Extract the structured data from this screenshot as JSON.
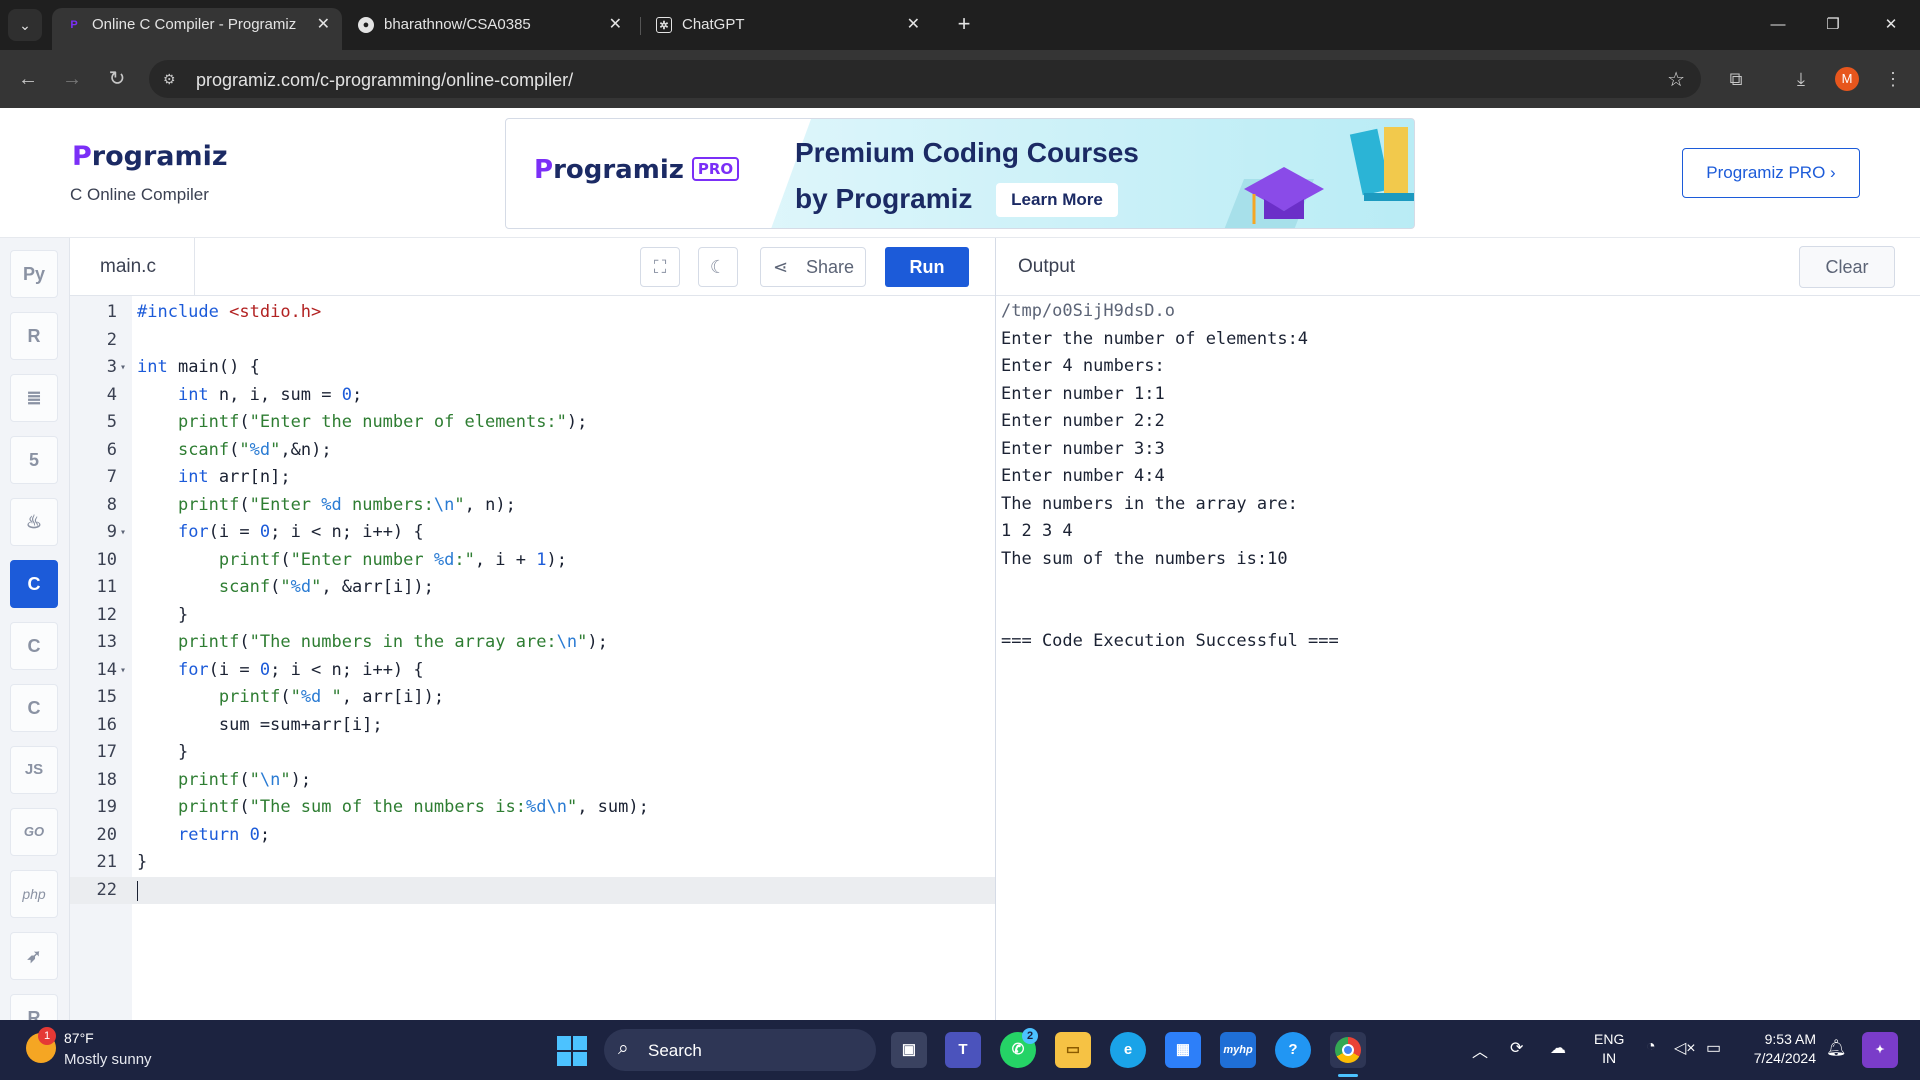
{
  "browser": {
    "tabs": [
      {
        "title": "Online C Compiler - Programiz",
        "icon": "programiz-favicon",
        "active": true
      },
      {
        "title": "bharathnow/CSA0385",
        "icon": "github-icon",
        "active": false
      },
      {
        "title": "ChatGPT",
        "icon": "chatgpt-icon",
        "active": false
      }
    ],
    "url": "programiz.com/c-programming/online-compiler/",
    "profile_initial": "M"
  },
  "site": {
    "logo": "rogramiz",
    "logo_p": "P",
    "subtitle": "C Online Compiler",
    "banner": {
      "logo": "rogramiz",
      "logo_p": "P",
      "badge": "PRO",
      "title_line1": "Premium Coding Courses",
      "title_line2": "by Programiz",
      "cta": "Learn More"
    },
    "pro_button": "Programiz PRO ›"
  },
  "sidebar": {
    "languages": [
      {
        "name": "python",
        "glyph": "Py",
        "active": false
      },
      {
        "name": "r",
        "glyph": "R",
        "active": false
      },
      {
        "name": "sql",
        "glyph": "≣",
        "active": false
      },
      {
        "name": "html",
        "glyph": "5",
        "active": false
      },
      {
        "name": "java",
        "glyph": "♨",
        "active": false
      },
      {
        "name": "c",
        "glyph": "C",
        "active": true
      },
      {
        "name": "cpp",
        "glyph": "C",
        "active": false
      },
      {
        "name": "csharp",
        "glyph": "C",
        "active": false
      },
      {
        "name": "javascript",
        "glyph": "JS",
        "active": false
      },
      {
        "name": "go",
        "glyph": "GO",
        "active": false
      },
      {
        "name": "php",
        "glyph": "php",
        "active": false
      },
      {
        "name": "swift",
        "glyph": "➶",
        "active": false
      },
      {
        "name": "rust",
        "glyph": "R",
        "active": false
      }
    ]
  },
  "editor": {
    "filename": "main.c",
    "share_label": "Share",
    "run_label": "Run",
    "lines": [
      {
        "n": "1",
        "text": "#include <stdio.h>",
        "fold": ""
      },
      {
        "n": "2",
        "text": "",
        "fold": ""
      },
      {
        "n": "3",
        "text": "int main() {",
        "fold": "▾"
      },
      {
        "n": "4",
        "text": "    int n, i, sum = 0;",
        "fold": ""
      },
      {
        "n": "5",
        "text": "    printf(\"Enter the number of elements:\");",
        "fold": ""
      },
      {
        "n": "6",
        "text": "    scanf(\"%d\",&n);",
        "fold": ""
      },
      {
        "n": "7",
        "text": "    int arr[n];",
        "fold": ""
      },
      {
        "n": "8",
        "text": "    printf(\"Enter %d numbers:\\n\", n);",
        "fold": ""
      },
      {
        "n": "9",
        "text": "    for(i = 0; i < n; i++) {",
        "fold": "▾"
      },
      {
        "n": "10",
        "text": "        printf(\"Enter number %d:\", i + 1);",
        "fold": ""
      },
      {
        "n": "11",
        "text": "        scanf(\"%d\", &arr[i]);",
        "fold": ""
      },
      {
        "n": "12",
        "text": "    }",
        "fold": ""
      },
      {
        "n": "13",
        "text": "    printf(\"The numbers in the array are:\\n\");",
        "fold": ""
      },
      {
        "n": "14",
        "text": "    for(i = 0; i < n; i++) {",
        "fold": "▾"
      },
      {
        "n": "15",
        "text": "        printf(\"%d \", arr[i]);",
        "fold": ""
      },
      {
        "n": "16",
        "text": "        sum =sum+arr[i];",
        "fold": ""
      },
      {
        "n": "17",
        "text": "    }",
        "fold": ""
      },
      {
        "n": "18",
        "text": "    printf(\"\\n\");",
        "fold": ""
      },
      {
        "n": "19",
        "text": "    printf(\"The sum of the numbers is:%d\\n\", sum);",
        "fold": ""
      },
      {
        "n": "20",
        "text": "    return 0;",
        "fold": ""
      },
      {
        "n": "21",
        "text": "}",
        "fold": ""
      },
      {
        "n": "22",
        "text": "",
        "fold": ""
      }
    ]
  },
  "output": {
    "title": "Output",
    "clear_label": "Clear",
    "lines": [
      "/tmp/o0SijH9dsD.o",
      "Enter the number of elements:4",
      "Enter 4 numbers:",
      "Enter number 1:1",
      "Enter number 2:2",
      "Enter number 3:3",
      "Enter number 4:4",
      "The numbers in the array are:",
      "1 2 3 4 ",
      "The sum of the numbers is:10",
      "",
      "",
      "=== Code Execution Successful ==="
    ]
  },
  "taskbar": {
    "weather_temp": "87°F",
    "weather_condition": "Mostly sunny",
    "weather_badge": "1",
    "search_label": "Search",
    "whatsapp_badge": "2",
    "lang_line1": "ENG",
    "lang_line2": "IN",
    "time": "9:53 AM",
    "date": "7/24/2024"
  }
}
